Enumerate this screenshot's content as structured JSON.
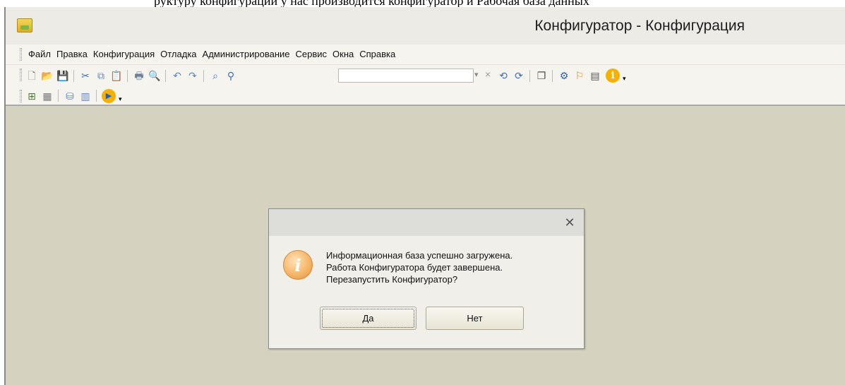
{
  "top_strip_text": "руктуру конфигурации у нас производится конфигуратор и Рабочая база данных",
  "window": {
    "title": "Конфигуратор - Конфигурация",
    "icon": "1c-app-icon"
  },
  "menu": {
    "items": [
      {
        "label": "Файл"
      },
      {
        "label": "Правка"
      },
      {
        "label": "Конфигурация"
      },
      {
        "label": "Отладка"
      },
      {
        "label": "Администрирование"
      },
      {
        "label": "Сервис"
      },
      {
        "label": "Окна"
      },
      {
        "label": "Справка"
      }
    ]
  },
  "toolbar": {
    "search_combo_value": "",
    "icons_row1": [
      "new-document-icon",
      "open-icon",
      "save-icon",
      "cut-icon",
      "copy-icon",
      "paste-icon",
      "print-icon",
      "print-preview-icon",
      "undo-icon",
      "redo-icon",
      "find-in-tree-icon",
      "search-icon",
      "dropdown-icon",
      "clear-icon",
      "search-prev-icon",
      "search-next-icon",
      "windows-icon",
      "wizard-icon",
      "syntax-helper-icon",
      "template-icon",
      "info-icon"
    ],
    "icons_row2": [
      "tree-icon",
      "properties-icon",
      "database-icon",
      "table-icon",
      "run-debug-icon"
    ]
  },
  "dialog": {
    "message_lines": [
      "Информационная база успешно загружена.",
      "Работа Конфигуратора будет завершена.",
      "Перезапустить Конфигуратор?"
    ],
    "yes_label": "Да",
    "no_label": "Нет",
    "close_glyph": "✕",
    "info_glyph": "i"
  },
  "colors": {
    "workspace": "#d5d2c0",
    "toolbar": "#f5f4ee",
    "dialog": "#f0efea",
    "info_icon": "#f5b76a"
  }
}
